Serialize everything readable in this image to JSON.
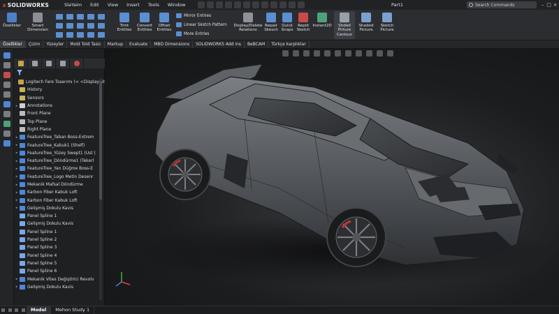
{
  "app": {
    "name": "SOLIDWORKS",
    "document_title": "Part1"
  },
  "menu": [
    "SlaYaim",
    "Edit",
    "View",
    "Insert",
    "Tools",
    "Window"
  ],
  "search": {
    "placeholder": "Search Commands"
  },
  "ribbon": {
    "ozellikler": "Özellikler",
    "smart_dimension": "Smart\nDimension",
    "trim_entities": "Trmt\nEntities",
    "convert_entities": "Convert\nEntities",
    "offset_entities": "Offset\nEntities",
    "mirror_entries": "Mirror Entries",
    "linear_sketch_pattern": "Linear Skstch Pattern",
    "more_entries": "More Entries",
    "display_delete_relations": "Display/Delete\nRelations",
    "repair_sketch": "Repair\nSkesch",
    "quick_snaps": "Quick\nSnaps",
    "rapid_sketch": "Repid\nSketch",
    "instant2d": "Instant2D",
    "shaded_picture_contour": "Shded\nPirture\nCentour",
    "shaded_picture": "Shaded\nPicture",
    "sketch_picture": "Sketch\nPicture"
  },
  "tabs": [
    "Özellikler",
    "Çizim",
    "Yüzeyler",
    "Mold Told Tasic",
    "Markup",
    "Evaluate",
    "MBD Dimensions",
    "SOLIDWORKS Add ins",
    "BeBCAM",
    "Türkçe karplıklar"
  ],
  "feature_tree": [
    {
      "label": "Logitech Fare Tsaarımı (< <Display St",
      "arrow": "",
      "icon": "part"
    },
    {
      "label": "History",
      "arrow": "",
      "icon": "folder"
    },
    {
      "label": "Sensors",
      "arrow": "",
      "icon": "folder"
    },
    {
      "label": "Annotations",
      "arrow": "▸",
      "icon": "annot"
    },
    {
      "label": "Front Plane",
      "arrow": "",
      "icon": "plane"
    },
    {
      "label": "Top Plane",
      "arrow": "",
      "icon": "plane"
    },
    {
      "label": "Right Plane",
      "arrow": "",
      "icon": "plane"
    },
    {
      "label": "FeatureTree_Taban Boss-Extrem",
      "arrow": "▸",
      "icon": "feature"
    },
    {
      "label": "FeatureTree_Kabuk1 (Shelf)",
      "arrow": "▸",
      "icon": "feature"
    },
    {
      "label": "FeatureTree_Yüzey Swept1 (Ust (",
      "arrow": "▸",
      "icon": "feature"
    },
    {
      "label": "FeatureTree_Döndürme1 (Tekerl",
      "arrow": "▸",
      "icon": "feature"
    },
    {
      "label": "FeatureTree_Yan Düğme Boss-E",
      "arrow": "▸",
      "icon": "feature"
    },
    {
      "label": "FeatureTree_Logo Metin Desenr",
      "arrow": "▸",
      "icon": "feature"
    },
    {
      "label": "Mekanik Mafsal Döndürme",
      "arrow": "▸",
      "icon": "feature"
    },
    {
      "label": "Karbon Fiber Kabuk Loft",
      "arrow": "▸",
      "icon": "feature"
    },
    {
      "label": "Karbon Fiber Kabuk Loft",
      "arrow": "▸",
      "icon": "feature"
    },
    {
      "label": "Gelişmiş Dokulu Kavis",
      "arrow": "▸",
      "icon": "feature"
    },
    {
      "label": "Panel Spline 1",
      "arrow": "",
      "icon": "spline"
    },
    {
      "label": "Gelişmiş Dokulu Kavis",
      "arrow": "",
      "icon": "spline"
    },
    {
      "label": "Panel Spline 1",
      "arrow": "",
      "icon": "spline"
    },
    {
      "label": "Panel Spline 2",
      "arrow": "",
      "icon": "spline"
    },
    {
      "label": "Panel Spline 3",
      "arrow": "",
      "icon": "spline"
    },
    {
      "label": "Panel Spline 4",
      "arrow": "",
      "icon": "spline"
    },
    {
      "label": "Panel Spline 5",
      "arrow": "",
      "icon": "spline"
    },
    {
      "label": "Panel Spline 6",
      "arrow": "",
      "icon": "spline"
    },
    {
      "label": "Mekanik Vites Değiştirici Revolv",
      "arrow": "▸",
      "icon": "feature"
    },
    {
      "label": "Gelişmiş Dokulu Kavis",
      "arrow": "▸",
      "icon": "feature"
    }
  ],
  "bottom_tabs": [
    "Model",
    "Mehon Study 1"
  ],
  "icon_colors": {
    "part": "#c9a24a",
    "folder": "#c9b25a",
    "annot": "#d0d0d0",
    "plane": "#bcbcbc",
    "feature": "#4f86d6",
    "spline": "#7aa8e6"
  }
}
